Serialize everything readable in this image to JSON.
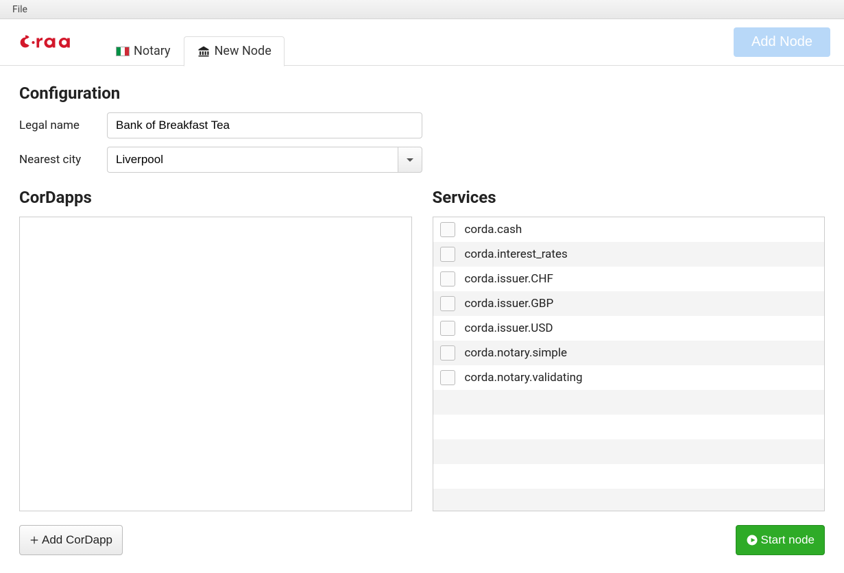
{
  "menu": {
    "file": "File"
  },
  "tabs": {
    "notary": {
      "label": "Notary"
    },
    "newnode": {
      "label": "New Node"
    }
  },
  "buttons": {
    "add_node": "Add Node",
    "add_cordapp": "Add CorDapp",
    "start_node": "Start node"
  },
  "sections": {
    "configuration": "Configuration",
    "cordapps": "CorDapps",
    "services": "Services"
  },
  "form": {
    "legal_name_label": "Legal name",
    "legal_name_value": "Bank of Breakfast Tea",
    "nearest_city_label": "Nearest city",
    "nearest_city_value": "Liverpool"
  },
  "services": [
    {
      "label": "corda.cash",
      "checked": false
    },
    {
      "label": "corda.interest_rates",
      "checked": false
    },
    {
      "label": "corda.issuer.CHF",
      "checked": false
    },
    {
      "label": "corda.issuer.GBP",
      "checked": false
    },
    {
      "label": "corda.issuer.USD",
      "checked": false
    },
    {
      "label": "corda.notary.simple",
      "checked": false
    },
    {
      "label": "corda.notary.validating",
      "checked": false
    }
  ]
}
